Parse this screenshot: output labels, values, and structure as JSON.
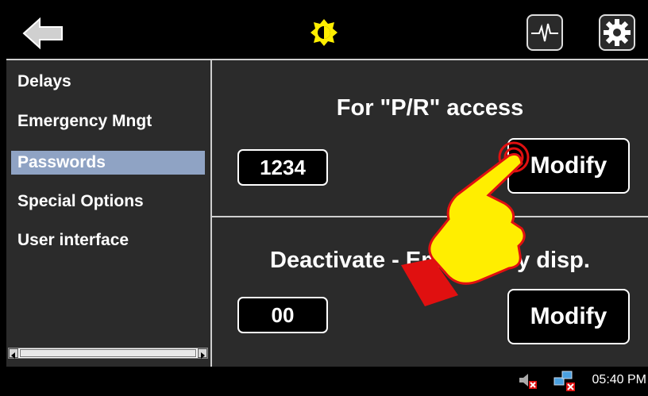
{
  "header": {
    "icons": [
      "back-arrow-icon",
      "brightness-icon",
      "signal-monitor-icon",
      "settings-gear-icon"
    ]
  },
  "sidebar": {
    "items": [
      {
        "label": "Delays",
        "active": false
      },
      {
        "label": "Emergency Mngt",
        "active": false
      },
      {
        "label": "Passwords",
        "active": true
      },
      {
        "label": "Special Options",
        "active": false
      },
      {
        "label": "User interface",
        "active": false
      }
    ]
  },
  "main": {
    "sections": [
      {
        "title": "For \"P/R\" access",
        "value": "1234",
        "button_label": "Modify"
      },
      {
        "title": "Deactivate - Emergency disp.",
        "value": "00",
        "button_label": "Modify"
      }
    ]
  },
  "taskbar": {
    "time": "05:40 PM",
    "icons": [
      "volume-muted-icon",
      "network-disconnected-icon"
    ]
  },
  "colors": {
    "background": "#2b2b2b",
    "selection": "#8fa3c4",
    "accent_yellow": "#ffee00",
    "cursor_red": "#e01010"
  }
}
